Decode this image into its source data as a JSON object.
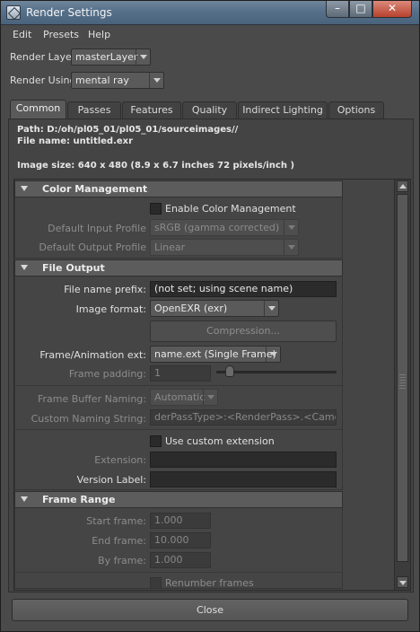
{
  "window": {
    "title": "Render Settings"
  },
  "menu": [
    "Edit",
    "Presets",
    "Help"
  ],
  "render_layer": {
    "label": "Render Layer",
    "value": "masterLayer"
  },
  "render_using": {
    "label": "Render Using",
    "value": "mental ray"
  },
  "tabs": [
    "Common",
    "Passes",
    "Features",
    "Quality",
    "Indirect Lighting",
    "Options"
  ],
  "active_tab": "Common",
  "info": {
    "path": "Path: D:/oh/pl05_01/pl05_01/sourceimages//",
    "file_name": "File name:  untitled.exr",
    "image_size": "Image size: 640 x 480 (8.9 x 6.7 inches 72 pixels/inch )"
  },
  "color_management": {
    "title": "Color Management",
    "enable_label": "Enable Color Management",
    "default_input_label": "Default Input Profile",
    "default_input_value": "sRGB (gamma corrected)",
    "default_output_label": "Default Output Profile",
    "default_output_value": "Linear"
  },
  "file_output": {
    "title": "File Output",
    "prefix_label": "File name prefix:",
    "prefix_value": "(not set; using scene name)",
    "format_label": "Image format:",
    "format_value": "OpenEXR (exr)",
    "compression_label": "Compression...",
    "frame_ext_label": "Frame/Animation ext:",
    "frame_ext_value": "name.ext (Single Frame)",
    "padding_label": "Frame padding:",
    "padding_value": "1",
    "buffer_label": "Frame Buffer Naming:",
    "buffer_value": "Automatic",
    "custom_string_label": "Custom Naming String:",
    "custom_string_value": "derPassType>:<RenderPass>.<Camera>",
    "custom_ext_label": "Use custom extension",
    "extension_label": "Extension:",
    "version_label": "Version Label:"
  },
  "frame_range": {
    "title": "Frame Range",
    "start_label": "Start frame:",
    "start_value": "1.000",
    "end_label": "End frame:",
    "end_value": "10.000",
    "by_label": "By frame:",
    "by_value": "1.000",
    "renumber_label": "Renumber frames"
  },
  "close_label": "Close"
}
